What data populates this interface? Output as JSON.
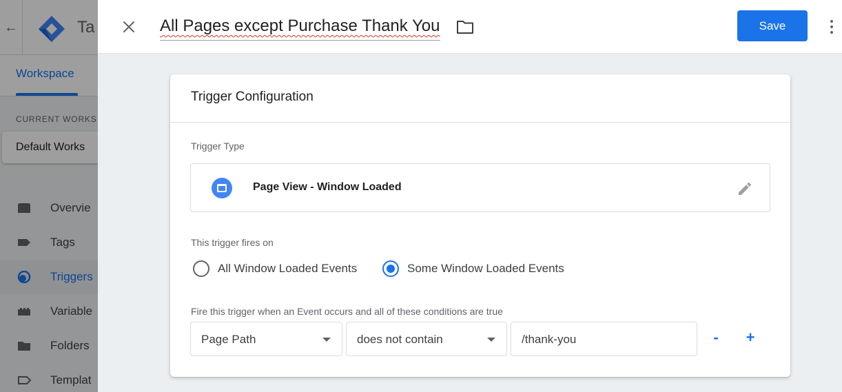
{
  "background": {
    "app_title": "Ta",
    "workspace_tab": "Workspace",
    "current_workspace_label": "CURRENT WORKS",
    "workspace_name": "Default Works",
    "nav": [
      {
        "label": "Overvie",
        "icon": "overview-icon"
      },
      {
        "label": "Tags",
        "icon": "tag-icon"
      },
      {
        "label": "Triggers",
        "icon": "trigger-icon",
        "active": true
      },
      {
        "label": "Variable",
        "icon": "variable-icon"
      },
      {
        "label": "Folders",
        "icon": "folder-icon"
      },
      {
        "label": "Templat",
        "icon": "template-icon"
      }
    ]
  },
  "header": {
    "title": "All Pages except Purchase Thank You",
    "save_label": "Save"
  },
  "card": {
    "title": "Trigger Configuration",
    "trigger_type_label": "Trigger Type",
    "trigger_type_name": "Page View - Window Loaded",
    "fires_on_label": "This trigger fires on",
    "fires_on_options": [
      {
        "label": "All Window Loaded Events",
        "selected": false
      },
      {
        "label": "Some Window Loaded Events",
        "selected": true
      }
    ],
    "conditions_label": "Fire this trigger when an Event occurs and all of these conditions are true",
    "condition": {
      "variable": "Page Path",
      "operator": "does not contain",
      "value": "/thank-you"
    },
    "remove_label": "-",
    "add_label": "+"
  },
  "colors": {
    "accent": "#1a73e8",
    "trigger_icon": "#4285f4"
  }
}
